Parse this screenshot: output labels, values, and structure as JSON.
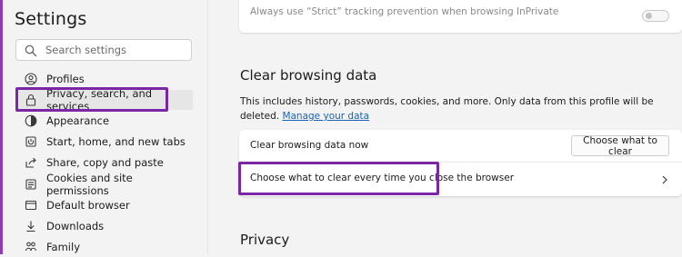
{
  "sidebar": {
    "title": "Settings",
    "search_placeholder": "Search settings",
    "items": [
      {
        "label": "Profiles",
        "icon": "profile-icon"
      },
      {
        "label": "Privacy, search, and services",
        "icon": "lock-icon"
      },
      {
        "label": "Appearance",
        "icon": "appearance-icon"
      },
      {
        "label": "Start, home, and new tabs",
        "icon": "power-icon"
      },
      {
        "label": "Share, copy and paste",
        "icon": "share-icon"
      },
      {
        "label": "Cookies and site permissions",
        "icon": "cookie-icon"
      },
      {
        "label": "Default browser",
        "icon": "browser-icon"
      },
      {
        "label": "Downloads",
        "icon": "download-icon"
      },
      {
        "label": "Family",
        "icon": "family-icon"
      }
    ],
    "active_item": "Privacy, search, and services"
  },
  "main": {
    "strict_tracking": {
      "label": "Always use “Strict” tracking prevention when browsing InPrivate",
      "enabled": false
    },
    "clear_section": {
      "title": "Clear browsing data",
      "description": "This includes history, passwords, cookies, and more. Only data from this profile will be deleted.",
      "manage_link_text": "Manage your data",
      "rows": {
        "clear_now_label": "Clear browsing data now",
        "clear_now_button": "Choose what to clear",
        "on_close_label": "Choose what to clear every time you close the browser"
      }
    },
    "privacy_section": {
      "title": "Privacy"
    }
  },
  "colors": {
    "highlight": "#7b26a5",
    "link": "#1a62b4",
    "active_bg": "#e6e6e6"
  }
}
